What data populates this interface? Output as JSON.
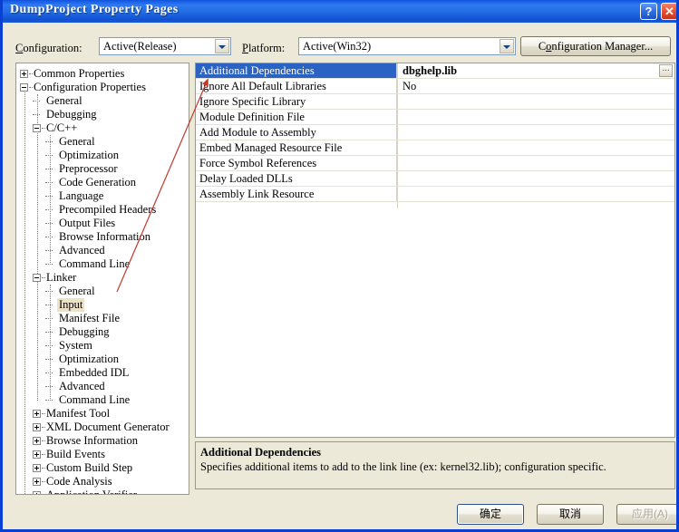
{
  "window": {
    "title": "DumpProject Property Pages",
    "help_button": "?",
    "close_button": "✕"
  },
  "toolbar": {
    "configuration_label_prefix": "C",
    "configuration_label_rest": "onfiguration:",
    "configuration_value": "Active(Release)",
    "platform_label_prefix": "P",
    "platform_label_rest": "latform:",
    "platform_value": "Active(Win32)",
    "config_manager_pre": "C",
    "config_manager_accel": "o",
    "config_manager_post": "nfiguration Manager..."
  },
  "tree": {
    "items": [
      {
        "label": "Common Properties",
        "indent": 0,
        "toggle": "plus",
        "selected": false
      },
      {
        "label": "Configuration Properties",
        "indent": 0,
        "toggle": "minus",
        "selected": false
      },
      {
        "label": "General",
        "indent": 1,
        "toggle": "none",
        "selected": false
      },
      {
        "label": "Debugging",
        "indent": 1,
        "toggle": "none",
        "selected": false
      },
      {
        "label": "C/C++",
        "indent": 1,
        "toggle": "minus",
        "selected": false
      },
      {
        "label": "General",
        "indent": 2,
        "toggle": "none",
        "selected": false
      },
      {
        "label": "Optimization",
        "indent": 2,
        "toggle": "none",
        "selected": false
      },
      {
        "label": "Preprocessor",
        "indent": 2,
        "toggle": "none",
        "selected": false
      },
      {
        "label": "Code Generation",
        "indent": 2,
        "toggle": "none",
        "selected": false
      },
      {
        "label": "Language",
        "indent": 2,
        "toggle": "none",
        "selected": false
      },
      {
        "label": "Precompiled Headers",
        "indent": 2,
        "toggle": "none",
        "selected": false
      },
      {
        "label": "Output Files",
        "indent": 2,
        "toggle": "none",
        "selected": false
      },
      {
        "label": "Browse Information",
        "indent": 2,
        "toggle": "none",
        "selected": false
      },
      {
        "label": "Advanced",
        "indent": 2,
        "toggle": "none",
        "selected": false
      },
      {
        "label": "Command Line",
        "indent": 2,
        "toggle": "none",
        "selected": false
      },
      {
        "label": "Linker",
        "indent": 1,
        "toggle": "minus",
        "selected": false
      },
      {
        "label": "General",
        "indent": 2,
        "toggle": "none",
        "selected": false
      },
      {
        "label": "Input",
        "indent": 2,
        "toggle": "none",
        "selected": true
      },
      {
        "label": "Manifest File",
        "indent": 2,
        "toggle": "none",
        "selected": false
      },
      {
        "label": "Debugging",
        "indent": 2,
        "toggle": "none",
        "selected": false
      },
      {
        "label": "System",
        "indent": 2,
        "toggle": "none",
        "selected": false
      },
      {
        "label": "Optimization",
        "indent": 2,
        "toggle": "none",
        "selected": false
      },
      {
        "label": "Embedded IDL",
        "indent": 2,
        "toggle": "none",
        "selected": false
      },
      {
        "label": "Advanced",
        "indent": 2,
        "toggle": "none",
        "selected": false
      },
      {
        "label": "Command Line",
        "indent": 2,
        "toggle": "none",
        "selected": false
      },
      {
        "label": "Manifest Tool",
        "indent": 1,
        "toggle": "plus",
        "selected": false
      },
      {
        "label": "XML Document Generator",
        "indent": 1,
        "toggle": "plus",
        "selected": false
      },
      {
        "label": "Browse Information",
        "indent": 1,
        "toggle": "plus",
        "selected": false
      },
      {
        "label": "Build Events",
        "indent": 1,
        "toggle": "plus",
        "selected": false
      },
      {
        "label": "Custom Build Step",
        "indent": 1,
        "toggle": "plus",
        "selected": false
      },
      {
        "label": "Code Analysis",
        "indent": 1,
        "toggle": "plus",
        "selected": false
      },
      {
        "label": "Application Verifier",
        "indent": 1,
        "toggle": "plus",
        "selected": false
      }
    ]
  },
  "grid": {
    "rows": [
      {
        "name": "Additional Dependencies",
        "value": "dbghelp.lib",
        "selected": true,
        "has_ellipsis": true
      },
      {
        "name": "Ignore All Default Libraries",
        "value": "No",
        "selected": false,
        "has_ellipsis": false
      },
      {
        "name": "Ignore Specific Library",
        "value": "",
        "selected": false,
        "has_ellipsis": false
      },
      {
        "name": "Module Definition File",
        "value": "",
        "selected": false,
        "has_ellipsis": false
      },
      {
        "name": "Add Module to Assembly",
        "value": "",
        "selected": false,
        "has_ellipsis": false
      },
      {
        "name": "Embed Managed Resource File",
        "value": "",
        "selected": false,
        "has_ellipsis": false
      },
      {
        "name": "Force Symbol References",
        "value": "",
        "selected": false,
        "has_ellipsis": false
      },
      {
        "name": "Delay Loaded DLLs",
        "value": "",
        "selected": false,
        "has_ellipsis": false
      },
      {
        "name": "Assembly Link Resource",
        "value": "",
        "selected": false,
        "has_ellipsis": false
      }
    ],
    "ellipsis_label": "..."
  },
  "description": {
    "title": "Additional Dependencies",
    "body": "Specifies additional items to add to the link line (ex: kernel32.lib); configuration specific."
  },
  "buttons": {
    "ok": "确定",
    "cancel": "取消",
    "apply": "应用(A)"
  },
  "annotation": {
    "arrow_color": "#c0392b"
  }
}
